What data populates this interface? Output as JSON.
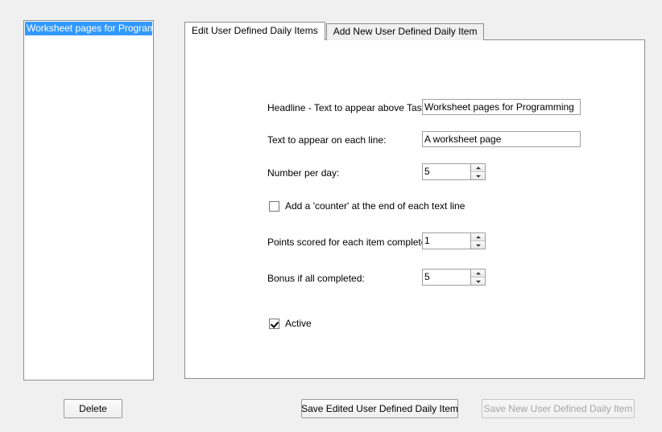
{
  "window": {
    "background_color": "#f0f0f0"
  },
  "item_list": {
    "items": [
      {
        "label": "Worksheet pages for Programming",
        "selected": true
      }
    ],
    "selection_color": "#3399ff"
  },
  "tabs": [
    {
      "label": "Edit User Defined Daily Items",
      "active": true
    },
    {
      "label": "Add New User Defined Daily Item",
      "active": false
    }
  ],
  "form": {
    "headline": {
      "label": "Headline - Text to appear above Task:",
      "value": "Worksheet pages for Programming"
    },
    "line_text": {
      "label": "Text to appear on each line:",
      "value": "A worksheet page"
    },
    "number_per_day": {
      "label": "Number per day:",
      "value": "5"
    },
    "counter_checkbox": {
      "label": "Add a 'counter' at the end of each text line",
      "checked": false
    },
    "points_per_item": {
      "label": "Points scored for each item completed:",
      "value": "1"
    },
    "bonus_all_completed": {
      "label": "Bonus if all completed:",
      "value": "5"
    },
    "active_checkbox": {
      "label": "Active",
      "checked": true
    }
  },
  "buttons": {
    "delete": {
      "label": "Delete",
      "enabled": true
    },
    "save_edited": {
      "label": "Save Edited User Defined Daily Item",
      "enabled": true
    },
    "save_new": {
      "label": "Save New User Defined Daily Item",
      "enabled": false
    }
  }
}
